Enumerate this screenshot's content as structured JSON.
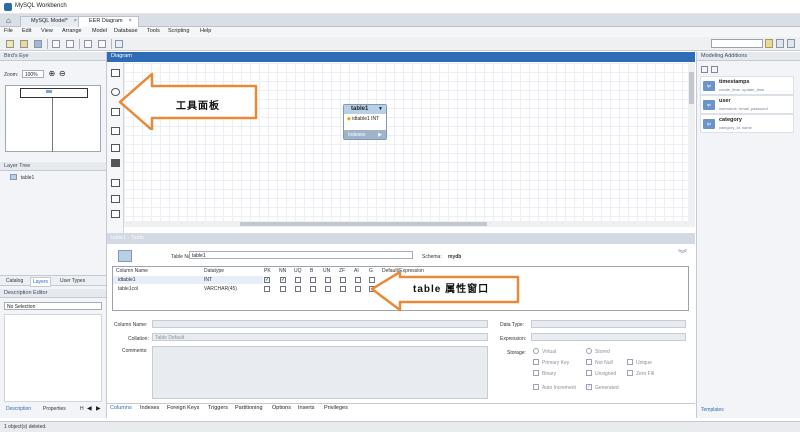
{
  "window": {
    "title": "MySQL Workbench"
  },
  "tabs": [
    {
      "label": "MySQL Model*"
    },
    {
      "label": "EER Diagram"
    }
  ],
  "menu": [
    "File",
    "Edit",
    "View",
    "Arrange",
    "Model",
    "Database",
    "Tools",
    "Scripting",
    "Help"
  ],
  "left_panel": {
    "birds_eye_title": "Bird's Eye",
    "zoom_label": "Zoom:",
    "zoom_value": "100%",
    "layer_tree_title": "Layer Tree",
    "layer_item": "table1",
    "tabs": [
      "Catalog",
      "Layers",
      "User Types"
    ],
    "description_title": "Description Editor",
    "selection_value": "No Selection",
    "bottom_tabs": [
      "Description",
      "Properties",
      "H"
    ]
  },
  "diagram": {
    "title": "Diagram",
    "table": {
      "name": "table1",
      "column": "idtable1 INT",
      "indexes": "Indexes"
    }
  },
  "callouts": {
    "tool_panel": "工具面板",
    "table_props": "table 属性窗口"
  },
  "right_panel": {
    "title": "Modeling Additions",
    "items": [
      {
        "title": "timestamps",
        "sub": "create_time, update_time"
      },
      {
        "title": "user",
        "sub": "username, email, password"
      },
      {
        "title": "category",
        "sub": "category_id, name"
      }
    ],
    "bottom_tab": "Templates"
  },
  "editor": {
    "header": "table1 - Table",
    "table_name_label": "Table Name:",
    "table_name_value": "table1",
    "schema_label": "Schema:",
    "schema_value": "mydb",
    "grid_headers": [
      "Column Name",
      "Datatype",
      "PK",
      "NN",
      "UQ",
      "B",
      "UN",
      "ZF",
      "AI",
      "G",
      "Default/Expression"
    ],
    "rows": [
      {
        "name": "idtable1",
        "type": "INT"
      },
      {
        "name": "table1col",
        "type": "VARCHAR(45)"
      }
    ],
    "column_name_label": "Column Name:",
    "collation_label": "Collation:",
    "collation_value": "Table Default",
    "comments_label": "Comments:",
    "data_type_label": "Data Type:",
    "expression_label": "Expression:",
    "storage_label": "Storage:",
    "options": {
      "virtual": "Virtual",
      "stored": "Stored",
      "primary_key": "Primary Key",
      "not_null": "Not Null",
      "unique": "Unique",
      "binary": "Binary",
      "unsigned": "Unsigned",
      "zero_fill": "Zero Fill",
      "auto_increment": "Auto Increment",
      "generated": "Generated"
    },
    "bottom_tabs": [
      "Columns",
      "Indexes",
      "Foreign Keys",
      "Triggers",
      "Partitioning",
      "Options",
      "Inserts",
      "Privileges"
    ]
  },
  "status": {
    "text": "1 object(s) deleted."
  },
  "colors": {
    "accent": "#2e6db5",
    "callout_border": "#e8893a"
  }
}
